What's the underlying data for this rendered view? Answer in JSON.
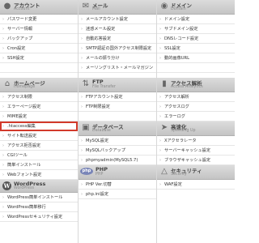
{
  "col1": {
    "account": {
      "title": "アカウント",
      "subtitle": "Account",
      "icon": "user-icon",
      "items": [
        "パスワード変更",
        "サーバー情報",
        "バックアップ",
        "Cron設定",
        "SSH設定"
      ]
    },
    "homepage": {
      "title": "ホームページ",
      "subtitle": "Homepage",
      "icon": "house-icon",
      "items": [
        "アクセス制限",
        "エラーページ設定",
        "MIME設定",
        ".htaccess編集",
        "サイト転送設定",
        "アクセス拒否設定",
        "CGIツール",
        "簡単インストール",
        "Webフォント設定"
      ],
      "selected": ".htaccess編集"
    },
    "wordpress": {
      "title": "WordPress",
      "subtitle": "WordPress",
      "icon": "wordpress-icon",
      "items": [
        "WordPress簡単インストール",
        "WordPress簡単移行",
        "WordPressセキュリティ設定"
      ]
    }
  },
  "col2": {
    "mail": {
      "title": "メール",
      "subtitle": "Mail",
      "icon": "mail-icon",
      "items": [
        "メールアカウント設定",
        "迷惑メール設定",
        "自動応答設定",
        "SMTP認証の国外アクセス制限設定",
        "メールの振り分け",
        "メーリングリスト・メールマガジン"
      ]
    },
    "ftp": {
      "title": "FTP",
      "subtitle": "File Transfer",
      "icon": "ftp-icon",
      "items": [
        "FTPアカウント設定",
        "FTP制限設定"
      ]
    },
    "database": {
      "title": "データベース",
      "subtitle": "Database",
      "icon": "database-icon",
      "items": [
        "MySQL設定",
        "MySQLバックアップ",
        "phpmyadmin(MySQL5.7)"
      ]
    },
    "php": {
      "title": "PHP",
      "subtitle": "PHP",
      "icon": "php-icon",
      "badge": "php",
      "items": [
        "PHP Ver.切替",
        "php.ini設定"
      ]
    }
  },
  "col3": {
    "domain": {
      "title": "ドメイン",
      "subtitle": "Domain",
      "icon": "globe-icon",
      "items": [
        "ドメイン設定",
        "サブドメイン設定",
        "DNSレコード設定",
        "SSL設定",
        "動的画像URL"
      ]
    },
    "access": {
      "title": "アクセス解析",
      "subtitle": "Access Analytics",
      "icon": "chart-icon",
      "items": [
        "アクセス解析",
        "アクセスログ",
        "エラーログ"
      ]
    },
    "speed": {
      "title": "高速化",
      "subtitle": "Speeding Up",
      "icon": "rocket-icon",
      "items": [
        "Xアクセラレータ",
        "サーバーキャッシュ設定",
        "ブラウザキャッシュ設定"
      ]
    },
    "security": {
      "title": "セキュリティ",
      "subtitle": "Security",
      "icon": "lock-icon",
      "items": [
        "WAF設定"
      ]
    }
  }
}
